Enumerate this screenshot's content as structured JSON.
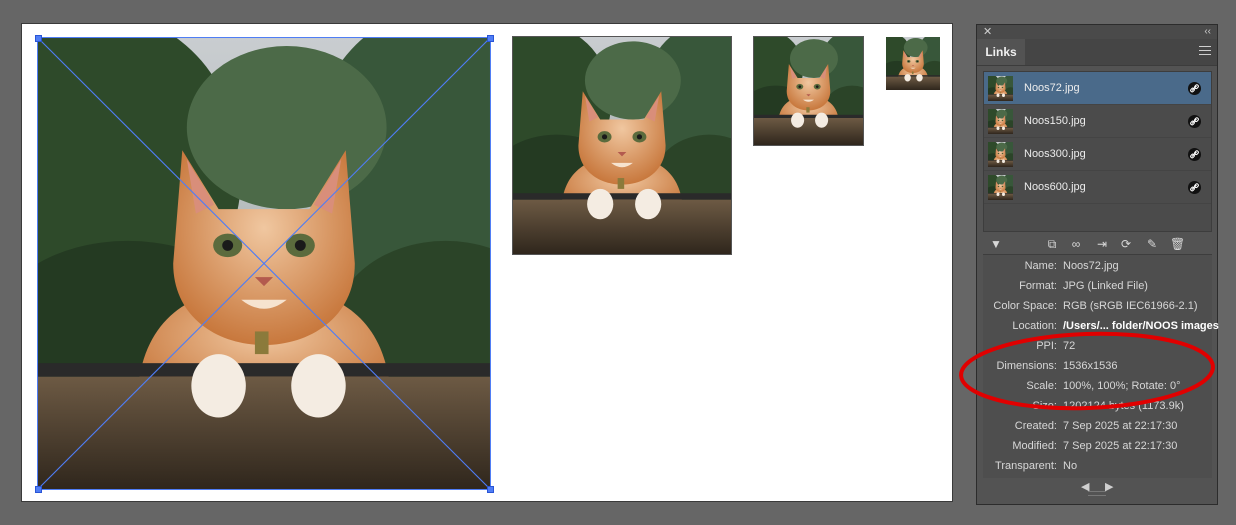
{
  "panel": {
    "close_glyph": "✕",
    "collapse_glyph": "‹‹",
    "tab_label": "Links",
    "links": [
      {
        "name": "Noos72.jpg",
        "selected": true
      },
      {
        "name": "Noos150.jpg",
        "selected": false
      },
      {
        "name": "Noos300.jpg",
        "selected": false
      },
      {
        "name": "Noos600.jpg",
        "selected": false
      }
    ],
    "toolbar_icons": [
      "disclosure-triangle-icon",
      "cc-libraries-icon",
      "relink-icon",
      "goto-link-icon",
      "update-link-icon",
      "edit-original-icon",
      "trash-icon"
    ],
    "info": {
      "name_label": "Name:",
      "name_value": "Noos72.jpg",
      "format_label": "Format:",
      "format_value": "JPG (Linked File)",
      "colorspace_label": "Color Space:",
      "colorspace_value": "RGB (sRGB IEC61966-2.1)",
      "location_label": "Location:",
      "location_value": "/Users/... folder/NOOS images",
      "ppi_label": "PPI:",
      "ppi_value": "72",
      "dimensions_label": "Dimensions:",
      "dimensions_value": "1536x1536",
      "scale_label": "Scale:",
      "scale_value": "100%, 100%; Rotate: 0°",
      "size_label": "Size:",
      "size_value": "1202124 bytes (1173.9k)",
      "created_label": "Created:",
      "created_value": "7 Sep 2025 at 22:17:30",
      "modified_label": "Modified:",
      "modified_value": "7 Sep 2025 at 22:17:30",
      "transparent_label": "Transparent:",
      "transparent_value": "No"
    },
    "nav_prev": "◀",
    "nav_next": "▶"
  },
  "colors": {
    "workspace": "#666666",
    "selection": "#4f7df5",
    "highlight_ellipse": "#e00000",
    "selected_row": "#4a6a8a"
  }
}
